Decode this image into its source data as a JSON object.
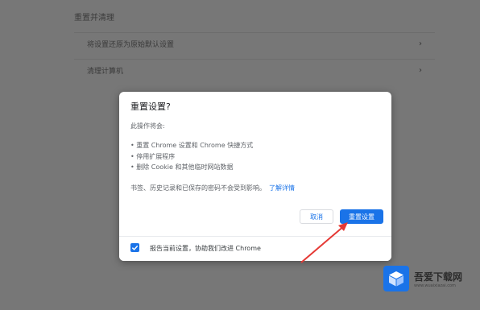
{
  "background": {
    "section_title": "重置并清理",
    "rows": [
      {
        "label": "将设置还原为原始默认设置",
        "chevron": "›"
      },
      {
        "label": "清理计算机",
        "chevron": "›"
      }
    ]
  },
  "dialog": {
    "title": "重置设置?",
    "intro": "此操作将会:",
    "bullets": [
      "• 重置 Chrome 设置和 Chrome 快捷方式",
      "• 停用扩展程序",
      "• 删除 Cookie 和其他临时网站数据"
    ],
    "note": "书签、历史记录和已保存的密码不会受到影响。",
    "learn_more": "了解详情",
    "cancel_label": "取消",
    "reset_label": "重置设置",
    "footer_label": "报告当前设置，协助我们改进 Chrome",
    "footer_checked": true
  },
  "watermark": {
    "name": "吾爱下载网",
    "url": "www.wuaixiazai.com"
  },
  "colors": {
    "accent": "#1a73e8",
    "arrow": "#e53935"
  }
}
